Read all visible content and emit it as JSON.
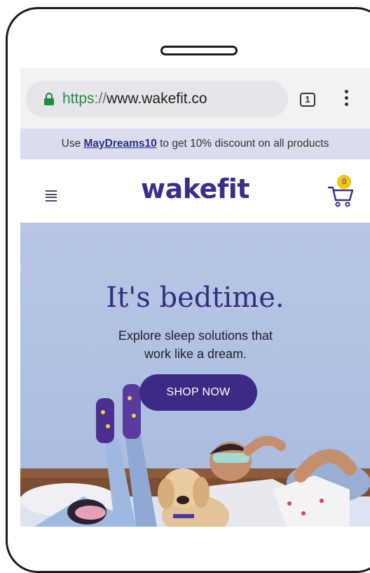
{
  "browser": {
    "url_scheme": "https",
    "url_separator": "://",
    "url_host": "www.wakefit.co",
    "tab_count": "1",
    "icons": {
      "lock": "lock-icon",
      "tabs": "tabs-icon",
      "menu": "menu-icon"
    }
  },
  "promo": {
    "prefix": "Use ",
    "code": "MayDreams10",
    "suffix": " to get 10% discount on all products"
  },
  "header": {
    "logo": "wakefit",
    "cart_count": "0",
    "icons": {
      "menu": "hamburger-icon",
      "cart": "cart-icon"
    }
  },
  "hero": {
    "title": "It's bedtime.",
    "subtitle": "Explore sleep solutions that work like a dream.",
    "cta": "SHOP NOW"
  },
  "colors": {
    "brand_purple": "#3b2d8a",
    "hero_bg": "#b8c7e6",
    "promo_bg": "#dcdcef",
    "badge_yellow": "#f5c518",
    "lock_green": "#1e8e3e"
  }
}
